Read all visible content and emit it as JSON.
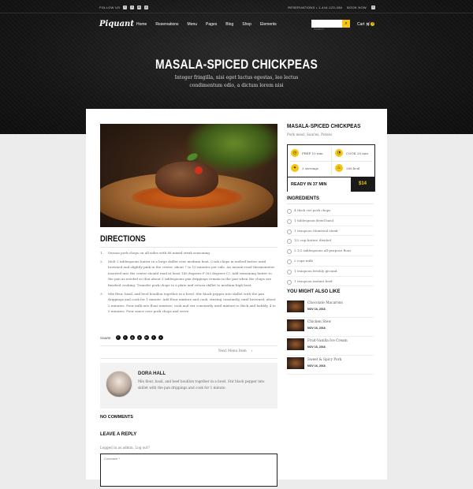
{
  "topbar": {
    "follow": "FOLLOW US",
    "social_icons": [
      "facebook-icon",
      "twitter-icon",
      "instagram-icon",
      "pinterest-icon"
    ],
    "reservations": "RESERVATIONS • 1-444-123-456",
    "book_now": "BOOK NOW"
  },
  "nav": {
    "logo": "Piquant",
    "items": [
      "Home",
      "Reservations",
      "Menu",
      "Pages",
      "Blog",
      "Shop",
      "Elements"
    ],
    "search_placeholder": "Search",
    "cart_label": "Cart",
    "cart_count": "0"
  },
  "hero": {
    "title": "MASALA-SPICED CHICKPEAS",
    "subtitle": "Integer fringilla, nisi eget luctus egestas, leo lectus condimentum odio, a dictum lorem nisi"
  },
  "directions": {
    "title": "DIRECTIONS",
    "steps": [
      "Season pork chops on all sides with 88 mixed steak seasoning.",
      "Melt 2 tablespoons butter in a large skillet over medium heat. Cook chops in melted butter until browned and slightly pink in the center, about 7 to 10 minutes per side. An instant-read thermometer inserted into the center should read at least 145 degrees F (63 degrees C). Add remaining butter to the pan as needed so that about 3 tablespoons pan drippings remain in the pan when the chops are finished cooking. Transfer pork chops to a plate and return skillet to medium-high heat.",
      "Mix flour, basil, and beef bouillon together in a bowl. Stir black pepper into skillet with the pan drippings and cook for 1 minute. Add flour mixture and cook, stirring constantly, until browned, about 2 minutes. Pour milk into flour mixture; cook and stir constantly until mixture is thick and bubbly, 4 to 5 minutes. Pour sauce over pork chops and serve."
    ]
  },
  "share": {
    "label": "SHARE",
    "icons": [
      "facebook-icon",
      "twitter-icon",
      "google-plus-icon",
      "pinterest-icon",
      "linkedin-icon",
      "tumblr-icon",
      "vk-icon"
    ]
  },
  "next_link": "Next Menu Item",
  "author": {
    "name": "DORA HALL",
    "bio": "Mix flour, basil, and beef bouillon together in a bowl. Stir black pepper into skillet with the pan drippings and cook for 1 minute."
  },
  "comments": {
    "no_comments": "NO COMMENTS",
    "leave_reply": "LEAVE A REPLY",
    "logged_in": "Logged in as admin. Log out?",
    "comment_placeholder": "Comment *"
  },
  "recipe": {
    "title": "MASALA-SPICED CHICKPEAS",
    "tags": "Pork meat, Sauces, Potato",
    "prep": "PREP 10 min",
    "cook": "COOK 28 min",
    "servings": "3 servings",
    "kcal": "286 kcal",
    "ready": "READY IN 37 MIN",
    "price": "$14"
  },
  "ingredients": {
    "title": "INGREDIENTS",
    "items": [
      "4 thick cut pork chops",
      "1 tablespoon dried basil",
      "1 teaspoon Montreal steak",
      "1/2 cup butter, divided",
      "2 1/2 tablespoons all-purpose flour",
      "2 cups milk",
      "1 teaspoon freshly ground",
      "1 teaspoon instant beef"
    ]
  },
  "also_like": {
    "title": "YOU MIGHT ALSO LIKE",
    "items": [
      {
        "title": "Chocolate Macarons",
        "date": "NOV 16, 2016"
      },
      {
        "title": "Chicken Stew",
        "date": "NOV 16, 2016"
      },
      {
        "title": "Fruit-Vanilla Ice Cream",
        "date": "NOV 16, 2016"
      },
      {
        "title": "Sweet & Spicy Pork",
        "date": "NOV 16, 2016"
      }
    ]
  },
  "colors": {
    "accent": "#f4c613",
    "dark": "#1a1a1a",
    "background": "#ececec"
  }
}
